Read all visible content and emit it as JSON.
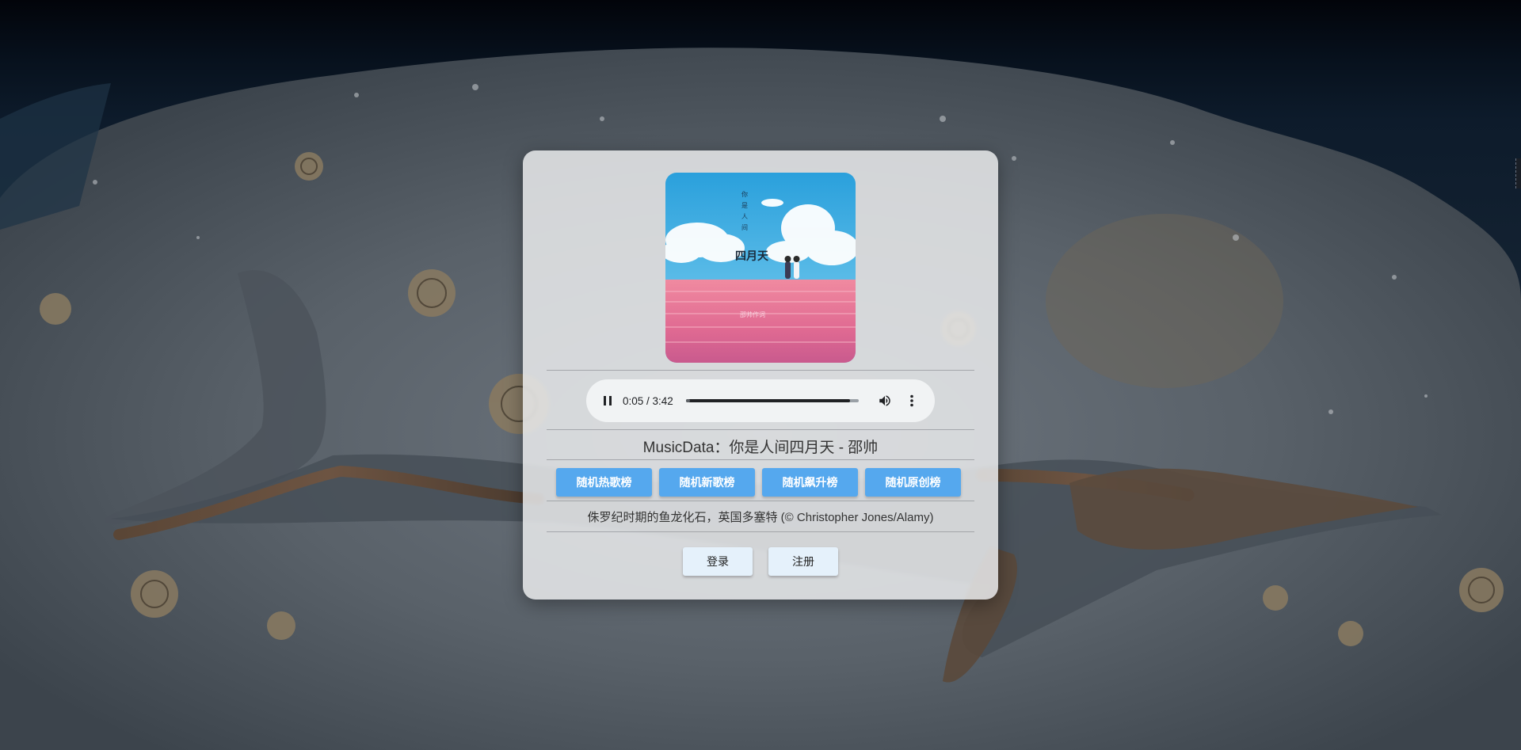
{
  "background": {
    "description_icon": "ichthyosaur-fossil-background"
  },
  "album": {
    "cover_title": "四月天",
    "cover_vertical_text": "你/是/人/间",
    "cover_signature": "邵帅作词"
  },
  "player": {
    "time_display": "0:05 / 3:42",
    "current": "0:05",
    "duration": "3:42",
    "progress_fraction": 0.023,
    "play_state_icon": "pause-icon",
    "volume_icon": "volume-icon",
    "more_icon": "more-vertical-icon"
  },
  "song": {
    "label": "MusicData：你是人间四月天 - 邵帅"
  },
  "rank_buttons": [
    {
      "label": "随机热歌榜"
    },
    {
      "label": "随机新歌榜"
    },
    {
      "label": "随机飙升榜"
    },
    {
      "label": "随机原创榜"
    }
  ],
  "caption": {
    "text": "侏罗纪时期的鱼龙化石，英国多塞特 (© Christopher Jones/Alamy)"
  },
  "auth": {
    "login_label": "登录",
    "register_label": "注册"
  },
  "colors": {
    "button_blue": "#55a8ee",
    "auth_button_bg": "#e5f1fb",
    "card_bg": "#ecedee"
  }
}
